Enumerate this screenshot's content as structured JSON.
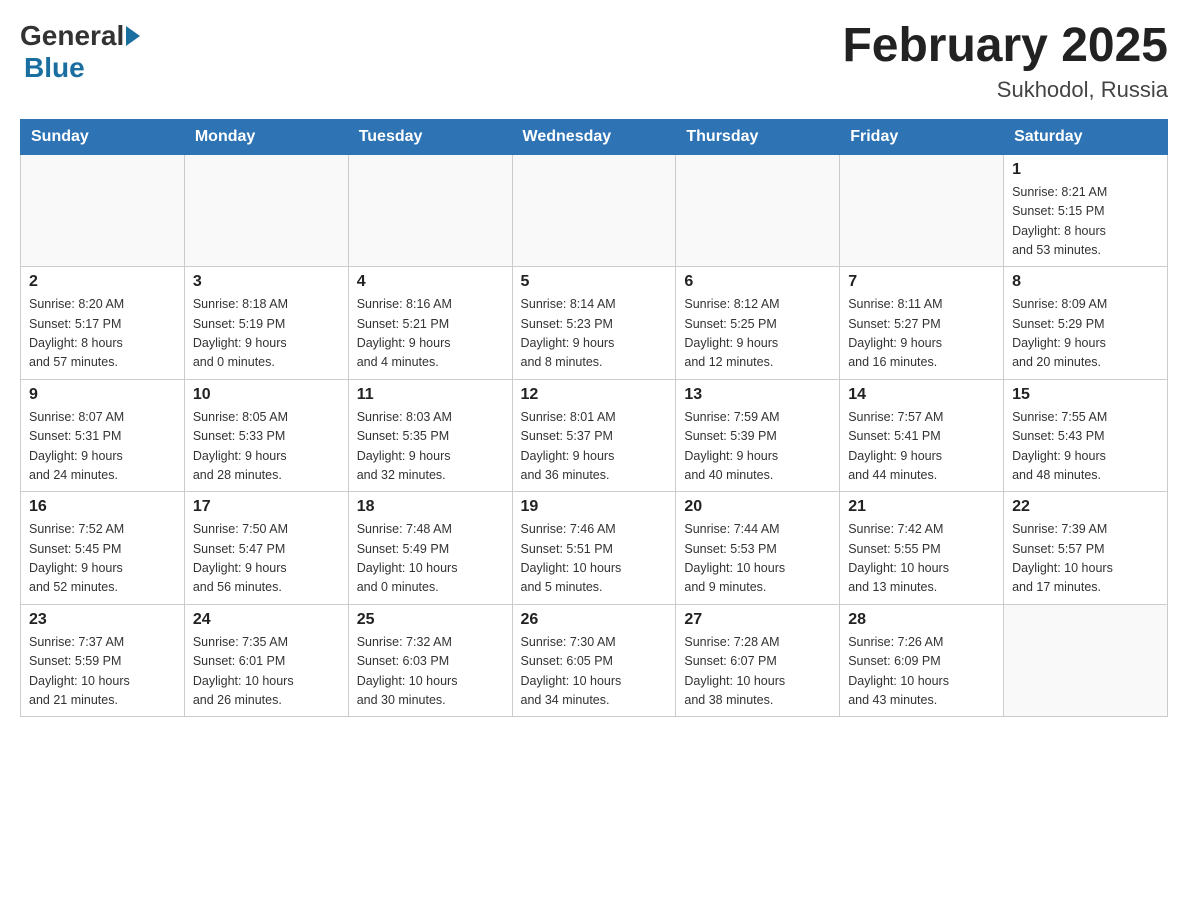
{
  "header": {
    "logo_general": "General",
    "logo_blue": "Blue",
    "title": "February 2025",
    "subtitle": "Sukhodol, Russia"
  },
  "weekdays": [
    "Sunday",
    "Monday",
    "Tuesday",
    "Wednesday",
    "Thursday",
    "Friday",
    "Saturday"
  ],
  "weeks": [
    [
      {
        "day": "",
        "info": ""
      },
      {
        "day": "",
        "info": ""
      },
      {
        "day": "",
        "info": ""
      },
      {
        "day": "",
        "info": ""
      },
      {
        "day": "",
        "info": ""
      },
      {
        "day": "",
        "info": ""
      },
      {
        "day": "1",
        "info": "Sunrise: 8:21 AM\nSunset: 5:15 PM\nDaylight: 8 hours\nand 53 minutes."
      }
    ],
    [
      {
        "day": "2",
        "info": "Sunrise: 8:20 AM\nSunset: 5:17 PM\nDaylight: 8 hours\nand 57 minutes."
      },
      {
        "day": "3",
        "info": "Sunrise: 8:18 AM\nSunset: 5:19 PM\nDaylight: 9 hours\nand 0 minutes."
      },
      {
        "day": "4",
        "info": "Sunrise: 8:16 AM\nSunset: 5:21 PM\nDaylight: 9 hours\nand 4 minutes."
      },
      {
        "day": "5",
        "info": "Sunrise: 8:14 AM\nSunset: 5:23 PM\nDaylight: 9 hours\nand 8 minutes."
      },
      {
        "day": "6",
        "info": "Sunrise: 8:12 AM\nSunset: 5:25 PM\nDaylight: 9 hours\nand 12 minutes."
      },
      {
        "day": "7",
        "info": "Sunrise: 8:11 AM\nSunset: 5:27 PM\nDaylight: 9 hours\nand 16 minutes."
      },
      {
        "day": "8",
        "info": "Sunrise: 8:09 AM\nSunset: 5:29 PM\nDaylight: 9 hours\nand 20 minutes."
      }
    ],
    [
      {
        "day": "9",
        "info": "Sunrise: 8:07 AM\nSunset: 5:31 PM\nDaylight: 9 hours\nand 24 minutes."
      },
      {
        "day": "10",
        "info": "Sunrise: 8:05 AM\nSunset: 5:33 PM\nDaylight: 9 hours\nand 28 minutes."
      },
      {
        "day": "11",
        "info": "Sunrise: 8:03 AM\nSunset: 5:35 PM\nDaylight: 9 hours\nand 32 minutes."
      },
      {
        "day": "12",
        "info": "Sunrise: 8:01 AM\nSunset: 5:37 PM\nDaylight: 9 hours\nand 36 minutes."
      },
      {
        "day": "13",
        "info": "Sunrise: 7:59 AM\nSunset: 5:39 PM\nDaylight: 9 hours\nand 40 minutes."
      },
      {
        "day": "14",
        "info": "Sunrise: 7:57 AM\nSunset: 5:41 PM\nDaylight: 9 hours\nand 44 minutes."
      },
      {
        "day": "15",
        "info": "Sunrise: 7:55 AM\nSunset: 5:43 PM\nDaylight: 9 hours\nand 48 minutes."
      }
    ],
    [
      {
        "day": "16",
        "info": "Sunrise: 7:52 AM\nSunset: 5:45 PM\nDaylight: 9 hours\nand 52 minutes."
      },
      {
        "day": "17",
        "info": "Sunrise: 7:50 AM\nSunset: 5:47 PM\nDaylight: 9 hours\nand 56 minutes."
      },
      {
        "day": "18",
        "info": "Sunrise: 7:48 AM\nSunset: 5:49 PM\nDaylight: 10 hours\nand 0 minutes."
      },
      {
        "day": "19",
        "info": "Sunrise: 7:46 AM\nSunset: 5:51 PM\nDaylight: 10 hours\nand 5 minutes."
      },
      {
        "day": "20",
        "info": "Sunrise: 7:44 AM\nSunset: 5:53 PM\nDaylight: 10 hours\nand 9 minutes."
      },
      {
        "day": "21",
        "info": "Sunrise: 7:42 AM\nSunset: 5:55 PM\nDaylight: 10 hours\nand 13 minutes."
      },
      {
        "day": "22",
        "info": "Sunrise: 7:39 AM\nSunset: 5:57 PM\nDaylight: 10 hours\nand 17 minutes."
      }
    ],
    [
      {
        "day": "23",
        "info": "Sunrise: 7:37 AM\nSunset: 5:59 PM\nDaylight: 10 hours\nand 21 minutes."
      },
      {
        "day": "24",
        "info": "Sunrise: 7:35 AM\nSunset: 6:01 PM\nDaylight: 10 hours\nand 26 minutes."
      },
      {
        "day": "25",
        "info": "Sunrise: 7:32 AM\nSunset: 6:03 PM\nDaylight: 10 hours\nand 30 minutes."
      },
      {
        "day": "26",
        "info": "Sunrise: 7:30 AM\nSunset: 6:05 PM\nDaylight: 10 hours\nand 34 minutes."
      },
      {
        "day": "27",
        "info": "Sunrise: 7:28 AM\nSunset: 6:07 PM\nDaylight: 10 hours\nand 38 minutes."
      },
      {
        "day": "28",
        "info": "Sunrise: 7:26 AM\nSunset: 6:09 PM\nDaylight: 10 hours\nand 43 minutes."
      },
      {
        "day": "",
        "info": ""
      }
    ]
  ]
}
